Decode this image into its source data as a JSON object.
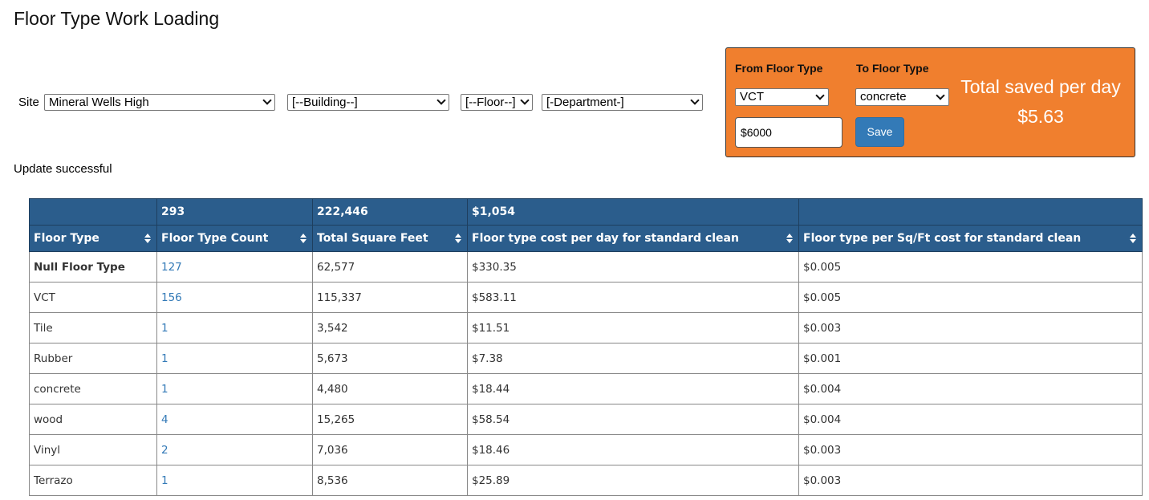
{
  "page_title": "Floor Type Work Loading",
  "filters": {
    "site_label": "Site",
    "site_value": "Mineral Wells High",
    "building_value": "[--Building--]",
    "floor_value": "[--Floor--]",
    "department_value": "[-Department-]"
  },
  "status_message": "Update successful",
  "savings_panel": {
    "from_label": "From Floor Type",
    "to_label": "To Floor Type",
    "from_value": "VCT",
    "to_value": "concrete",
    "amount_value": "$6000",
    "save_label": "Save",
    "total_title": "Total saved per day",
    "total_value": "$5.63",
    "panel_color": "#f07f2e"
  },
  "table": {
    "totals": [
      "",
      "293",
      "222,446",
      "$1,054",
      ""
    ],
    "headers": [
      "Floor Type",
      "Floor Type Count",
      "Total Square Feet",
      "Floor type cost per day for standard clean",
      "Floor type per Sq/Ft cost for standard clean"
    ],
    "header_color": "#2b5d8c",
    "rows": [
      [
        "Null Floor Type",
        "127",
        "62,577",
        "$330.35",
        "$0.005"
      ],
      [
        "VCT",
        "156",
        "115,337",
        "$583.11",
        "$0.005"
      ],
      [
        "Tile",
        "1",
        "3,542",
        "$11.51",
        "$0.003"
      ],
      [
        "Rubber",
        "1",
        "5,673",
        "$7.38",
        "$0.001"
      ],
      [
        "concrete",
        "1",
        "4,480",
        "$18.44",
        "$0.004"
      ],
      [
        "wood",
        "4",
        "15,265",
        "$58.54",
        "$0.004"
      ],
      [
        "Vinyl",
        "2",
        "7,036",
        "$18.46",
        "$0.003"
      ],
      [
        "Terrazo",
        "1",
        "8,536",
        "$25.89",
        "$0.003"
      ]
    ]
  }
}
